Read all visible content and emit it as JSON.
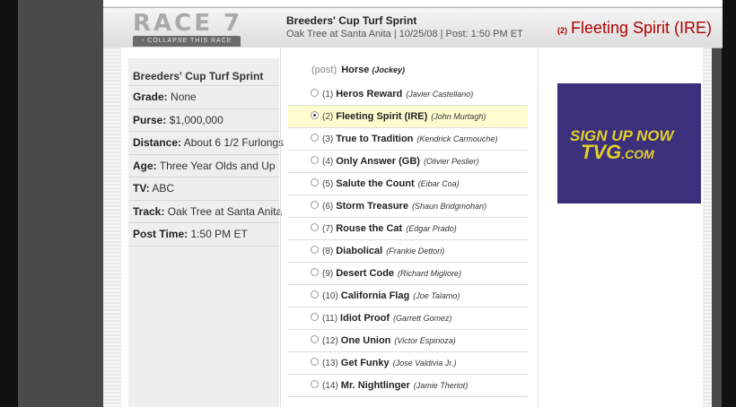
{
  "header": {
    "race_title": "RACE 7",
    "collapse_label": "- COLLAPSE THIS RACE",
    "race_name": "Breeders' Cup Turf Sprint",
    "race_sub": "Oak Tree at Santa Anita | 10/25/08 | Post: 1:50 PM ET",
    "winner_num": "(2)",
    "winner_name": "Fleeting Spirit (IRE)"
  },
  "info": {
    "title": "Breeders' Cup Turf Sprint",
    "rows": [
      {
        "label": "Grade:",
        "value": "None"
      },
      {
        "label": "Purse:",
        "value": "$1,000,000"
      },
      {
        "label": "Distance:",
        "value": "About 6 1/2 Furlongs"
      },
      {
        "label": "Age:",
        "value": "Three Year Olds and Up"
      },
      {
        "label": "TV:",
        "value": "ABC"
      },
      {
        "label": "Track:",
        "value": "Oak Tree at Santa Anita"
      },
      {
        "label": "Post Time:",
        "value": "1:50 PM ET"
      }
    ]
  },
  "list": {
    "head_post": "(post)",
    "head_horse": "Horse",
    "head_jockey": "(Jockey)",
    "horses": [
      {
        "num": "(1)",
        "name": "Heros Reward",
        "jockey": "(Javier Castellano)",
        "selected": false
      },
      {
        "num": "(2)",
        "name": "Fleeting Spirit (IRE)",
        "jockey": "(John Murtagh)",
        "selected": true
      },
      {
        "num": "(3)",
        "name": "True to Tradition",
        "jockey": "(Kendrick Carmouche)",
        "selected": false
      },
      {
        "num": "(4)",
        "name": "Only Answer (GB)",
        "jockey": "(Olivier Peslier)",
        "selected": false
      },
      {
        "num": "(5)",
        "name": "Salute the Count",
        "jockey": "(Eibar Coa)",
        "selected": false
      },
      {
        "num": "(6)",
        "name": "Storm Treasure",
        "jockey": "(Shaun Bridgmohan)",
        "selected": false
      },
      {
        "num": "(7)",
        "name": "Rouse the Cat",
        "jockey": "(Edgar Prado)",
        "selected": false
      },
      {
        "num": "(8)",
        "name": "Diabolical",
        "jockey": "(Frankie Dettori)",
        "selected": false
      },
      {
        "num": "(9)",
        "name": "Desert Code",
        "jockey": "(Richard Migliore)",
        "selected": false
      },
      {
        "num": "(10)",
        "name": "California Flag",
        "jockey": "(Joe Talamo)",
        "selected": false
      },
      {
        "num": "(11)",
        "name": "Idiot Proof",
        "jockey": "(Garrett Gomez)",
        "selected": false
      },
      {
        "num": "(12)",
        "name": "One Union",
        "jockey": "(Victor Espinoza)",
        "selected": false
      },
      {
        "num": "(13)",
        "name": "Get Funky",
        "jockey": "(Jose Valdivia Jr.)",
        "selected": false
      },
      {
        "num": "(14)",
        "name": "Mr. Nightlinger",
        "jockey": "(Jamie Theriot)",
        "selected": false
      }
    ]
  },
  "ad": {
    "line1": "SIGN UP NOW",
    "logo": "TVG",
    "logo_suffix": ".COM"
  },
  "colors": {
    "winner": "#b00000",
    "selected_row": "#fffdd0",
    "ad_background": "#3c2f7c",
    "ad_text": "#e3d12a"
  }
}
